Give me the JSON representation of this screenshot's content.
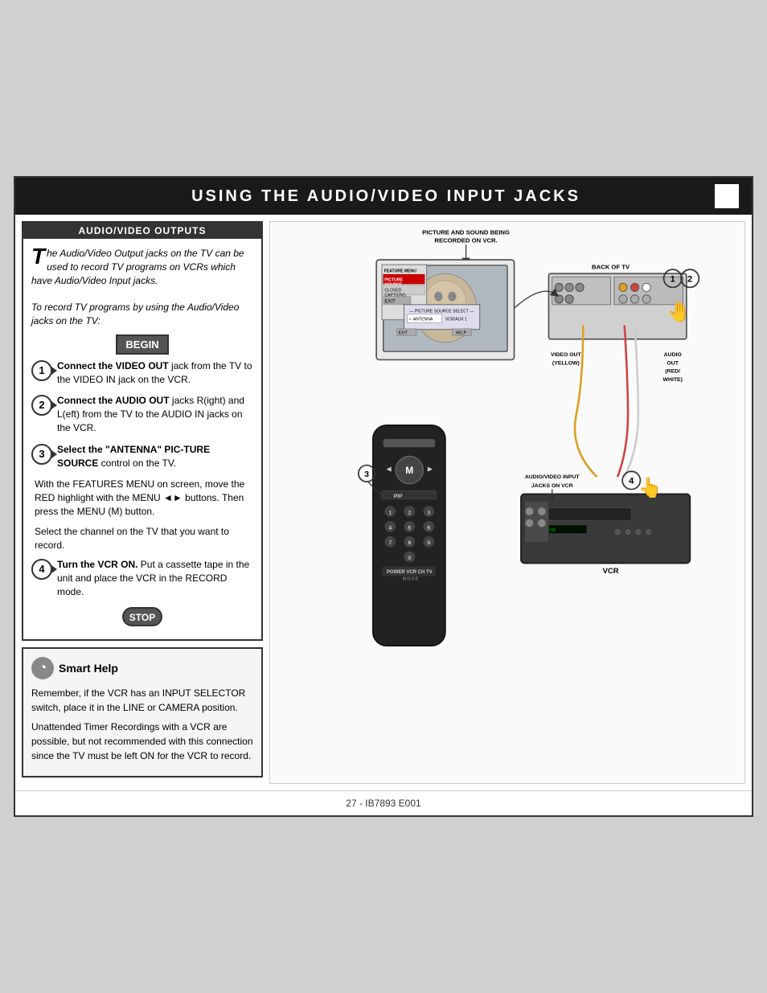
{
  "header": {
    "title": "Using the Audio/Video Input Jacks",
    "display_title": "U​SING THE A​UDIO/V​IDEO I​NPUT J​ACKS"
  },
  "av_outputs": {
    "section_title": "AUDIO/VIDEO OUTPUTS",
    "intro_drop": "T",
    "intro_text": "he Audio/Video Output jacks on the TV can be used to record TV programs on VCRs which have Audio/Video Input jacks.",
    "to_record_label": "To record TV programs by using the Audio/Video jacks on the TV:",
    "begin_label": "BEGIN",
    "step1_bold": "Connect the VIDEO OUT",
    "step1_text": " jack from the TV to the VIDEO IN jack on the VCR.",
    "step2_bold": "Connect the AUDIO OUT",
    "step2_text": " jacks R(ight) and L(eft) from the TV to the AUDIO IN jacks on the VCR.",
    "step3_bold": "Select the \"ANTENNA\" PIC-TURE SOURCE",
    "step3_text": " control on the TV.",
    "step3_sub1": "With the FEATURES MENU on screen, move the RED highlight with the MENU ◄► buttons. Then press the MENU (M) button.",
    "step3_sub2": "Select the channel on the TV that you want to record.",
    "step4_bold": "Turn the VCR ON.",
    "step4_text": " Put a cassette tape in the unit and place the VCR in the RECORD mode.",
    "stop_label": "STOP"
  },
  "smart_help": {
    "title": "Smart Help",
    "body1": "Remember, if the VCR has an INPUT SELECTOR switch, place it in the LINE or CAMERA position.",
    "body2": "Unattended Timer Recordings with a VCR are possible, but not recommended with this connection since the TV must be left ON for the VCR to record."
  },
  "diagram": {
    "picture_label": "PICTURE AND SOUND BEING RECORDED ON VCR.",
    "feature_menu_label": "FEATURE MENU",
    "back_of_tv_label": "BACK OF TV",
    "vcr_label": "VCR",
    "video_out_label": "VIDEO OUT (YELLOW)",
    "audio_out_label": "AUDIO OUT (RED/ WHITE)",
    "av_input_label": "AUDIO/VIDEO INPUT JACKS ON VCR",
    "step_numbers": [
      "1",
      "2",
      "3",
      "4"
    ],
    "menu_items": [
      "PICTURE SOURCE",
      "CLOSED CAPTIONS",
      "EXIT"
    ],
    "antenna_vcr_label": "ANTENNA VCR/AUX 1"
  },
  "footer": {
    "text": "27 - IB7893 E001"
  }
}
